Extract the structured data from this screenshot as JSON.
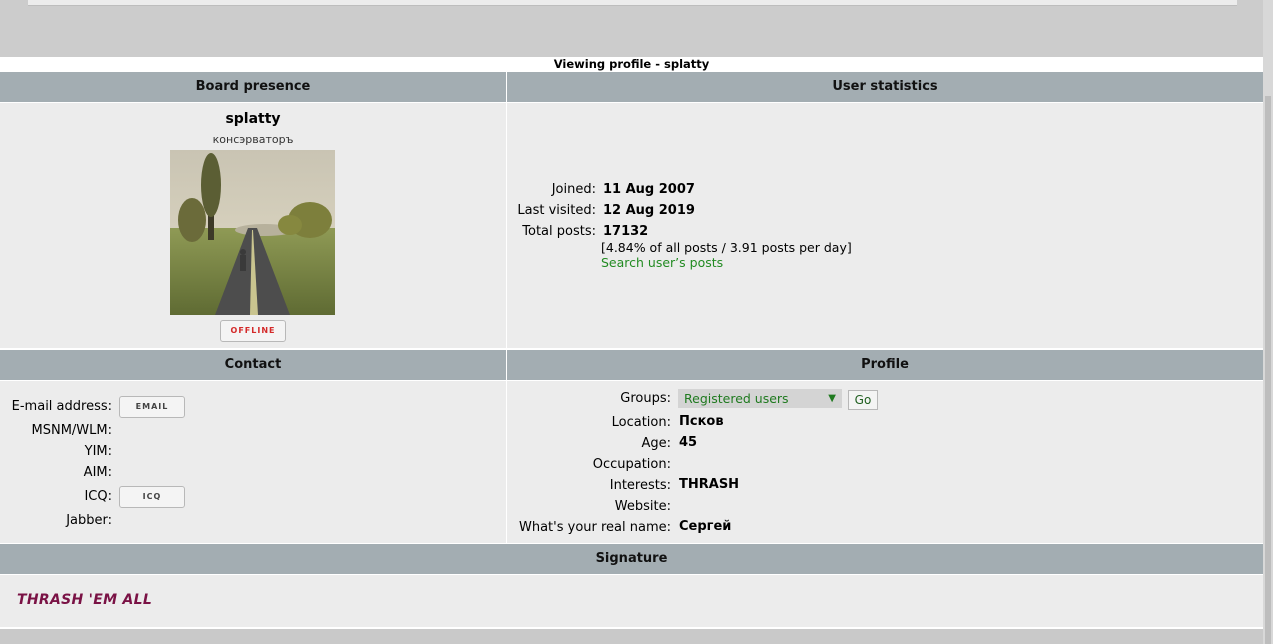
{
  "page": {
    "title": "Viewing profile - splatty"
  },
  "board_presence": {
    "header": "Board presence",
    "username": "splatty",
    "rank": "консэрваторъ",
    "status_label": "OFFLINE"
  },
  "user_statistics": {
    "header": "User statistics",
    "joined_label": "Joined:",
    "joined_value": "11 Aug 2007",
    "last_visited_label": "Last visited:",
    "last_visited_value": "12 Aug 2019",
    "total_posts_label": "Total posts:",
    "total_posts_value": "17132",
    "posts_detail": "[4.84% of all posts / 3.91 posts per day]",
    "search_link": "Search user’s posts"
  },
  "contact": {
    "header": "Contact",
    "email_label": "E-mail address:",
    "email_button": "EMAIL",
    "msnm_label": "MSNM/WLM:",
    "yim_label": "YIM:",
    "aim_label": "AIM:",
    "icq_label": "ICQ:",
    "icq_button": "ICQ",
    "jabber_label": "Jabber:"
  },
  "profile": {
    "header": "Profile",
    "groups_label": "Groups:",
    "groups_selected": "Registered users",
    "go_label": "Go",
    "location_label": "Location:",
    "location_value": "Псков",
    "age_label": "Age:",
    "age_value": "45",
    "occupation_label": "Occupation:",
    "interests_label": "Interests:",
    "interests_value": "THRASH",
    "website_label": "Website:",
    "real_name_label": "What's your real name:",
    "real_name_value": "Сергей"
  },
  "signature": {
    "header": "Signature",
    "text": "THRASH 'EM ALL"
  },
  "icons": {
    "select_arrow": "chevron-down-icon"
  }
}
